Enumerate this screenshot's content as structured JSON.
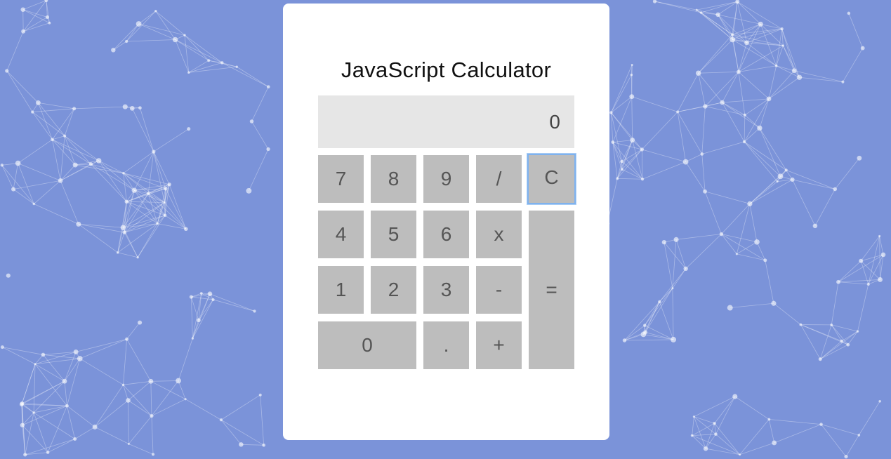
{
  "calculator": {
    "title": "JavaScript Calculator",
    "display_value": "0",
    "keys": {
      "seven": "7",
      "eight": "8",
      "nine": "9",
      "divide": "/",
      "clear": "C",
      "four": "4",
      "five": "5",
      "six": "6",
      "multiply": "x",
      "one": "1",
      "two": "2",
      "three": "3",
      "subtract": "-",
      "equals": "=",
      "zero": "0",
      "decimal": ".",
      "add": "+"
    },
    "focused_key": "clear"
  },
  "colors": {
    "background": "#7b93d9",
    "card": "#ffffff",
    "display": "#e6e6e6",
    "key": "#bdbdbd",
    "focus_ring": "#7fb2ee"
  }
}
